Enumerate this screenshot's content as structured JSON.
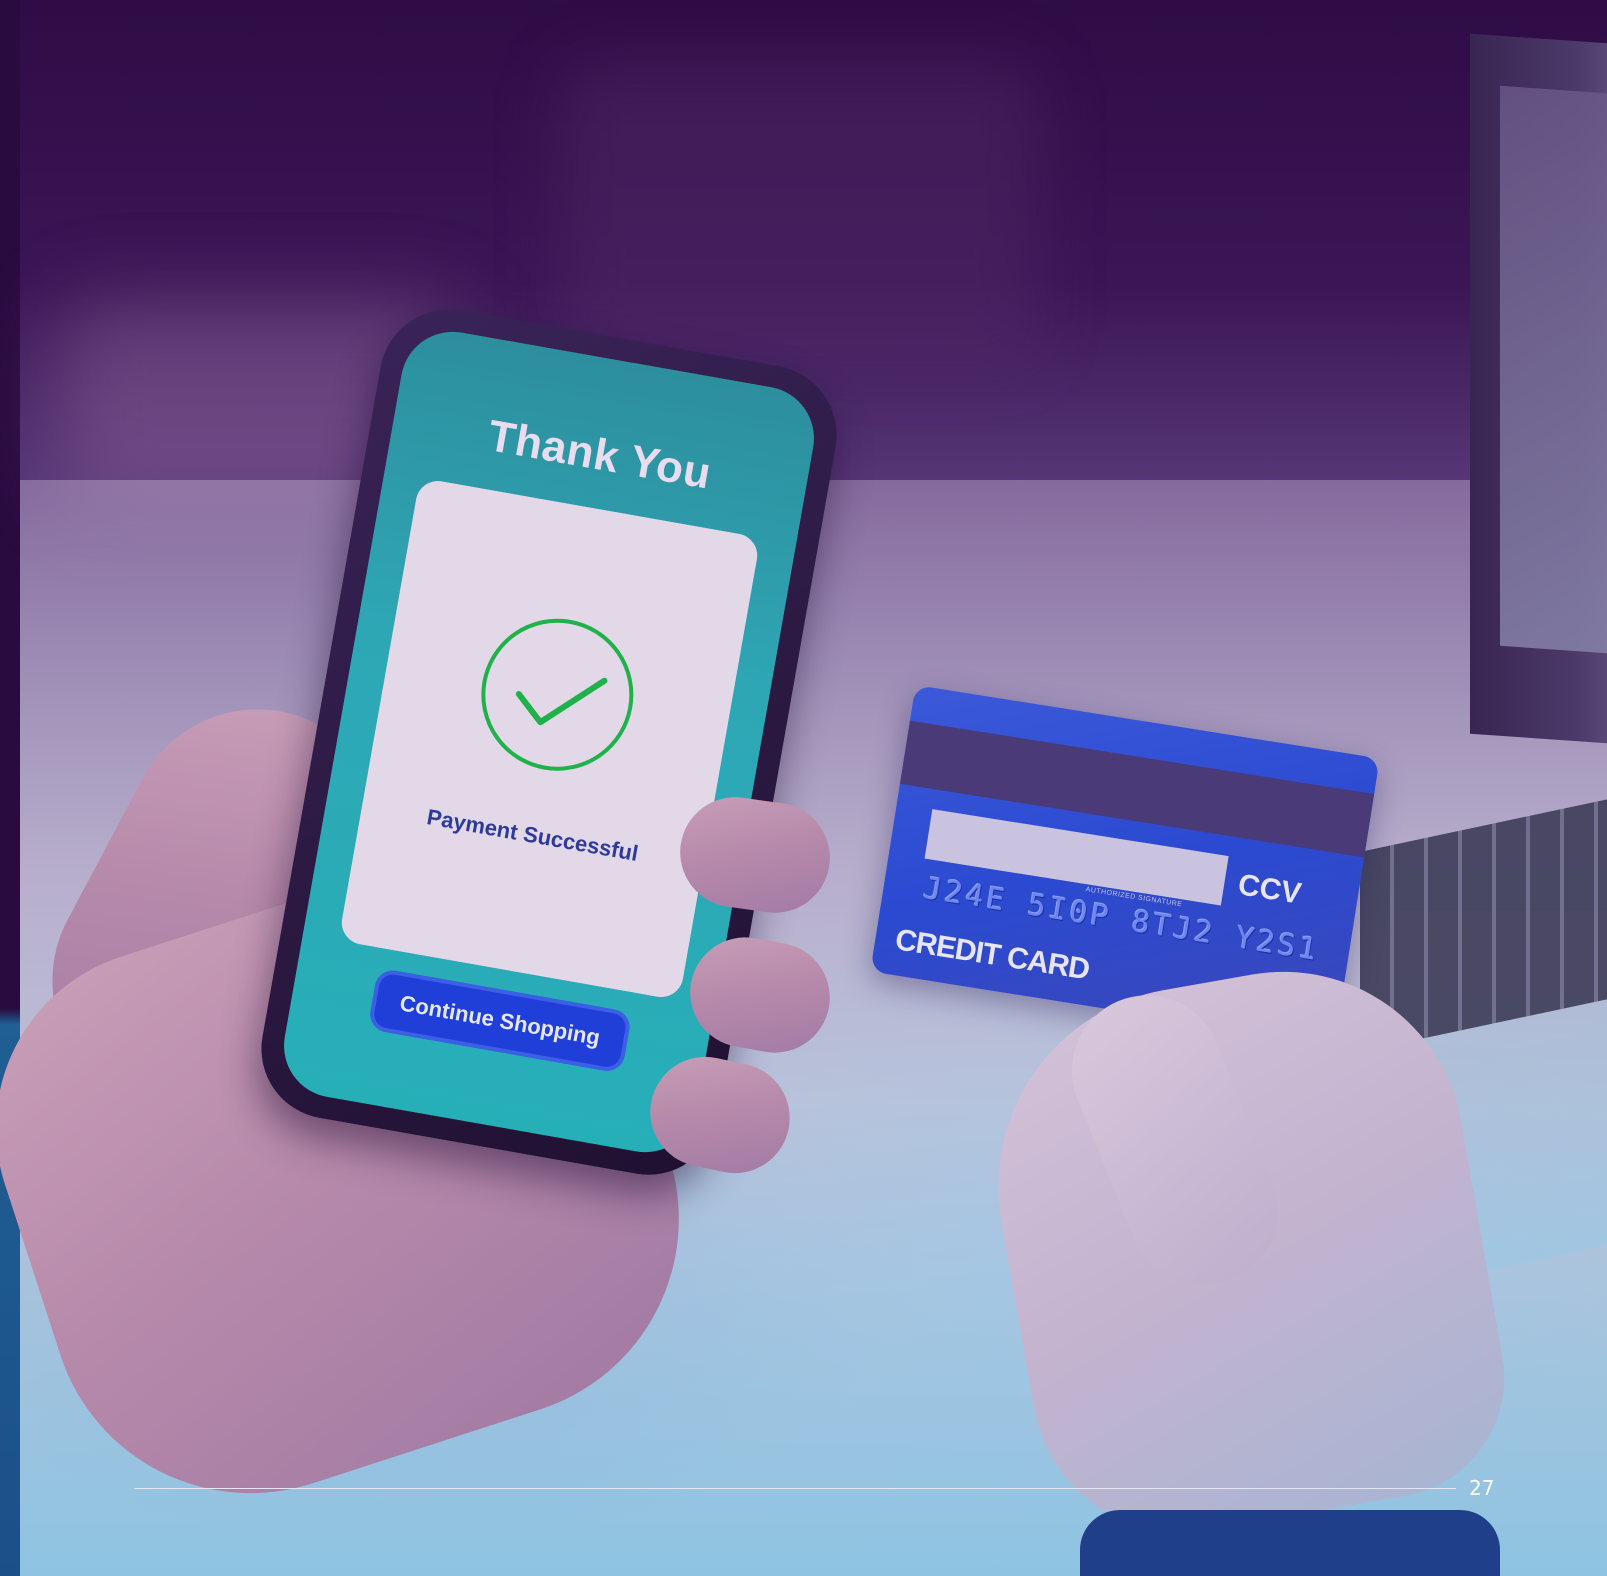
{
  "phone_screen": {
    "title": "Thank You",
    "status_text": "Payment Successful",
    "continue_button_label": "Continue Shopping",
    "check_icon": "check-circle-icon",
    "colors": {
      "screen": "#2ea7b5",
      "check": "#1fb24a",
      "button": "#1f3fd8"
    }
  },
  "credit_card": {
    "number": "J24E 5I0P 8TJ2 Y2S1",
    "ccv_label": "CCV",
    "card_label": "CREDIT CARD",
    "signature_label": "AUTHORIZED SIGNATURE"
  },
  "footer": {
    "page_number": "27"
  }
}
